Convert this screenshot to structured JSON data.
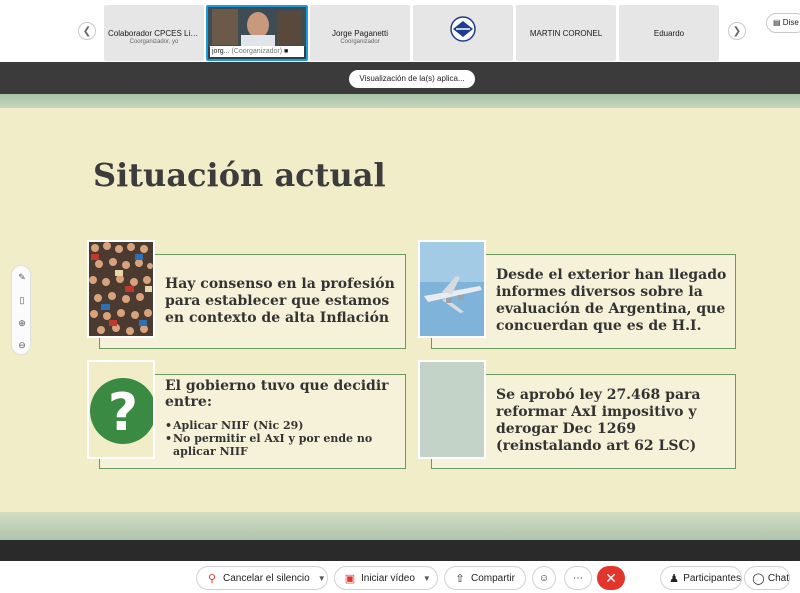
{
  "participants": [
    {
      "name": "Colaborador CPCES Liz ...",
      "role": "Coorganizador, yo"
    },
    {
      "name": "jorg...",
      "role": "(Coorganizador)"
    },
    {
      "name": "Jorge Paganetti",
      "role": "Coorganizador"
    },
    {
      "name": "",
      "role": ""
    },
    {
      "name": "MARTIN CORONEL",
      "role": ""
    },
    {
      "name": "Eduardo",
      "role": ""
    }
  ],
  "top": {
    "layout_button": "Dise"
  },
  "share_label": "Visualización de la(s) aplica...",
  "slide": {
    "title": "Situación actual",
    "box1": "Hay consenso en la profesión para establecer que estamos en contexto de alta Inflación",
    "box2": "Desde el exterior han llegado informes diversos sobre la evaluación de Argentina, que concuerdan que es de H.I.",
    "box3_head": "El gobierno tuvo que decidir entre:",
    "box3_bullets": [
      "Aplicar NIIF (Nic 29)",
      "No permitir el AxI y por ende no aplicar NIIF"
    ],
    "box4_line1": "Se aprobó ley 27.468 para",
    "box4_line2": "reformar AxI impositivo y",
    "box4_line3": "derogar  Dec 1269",
    "box4_line4": "(reinstalando art 62 LSC)"
  },
  "controls": {
    "mute": "Cancelar el silencio",
    "video": "Iniciar vídeo",
    "share": "Compartir",
    "participants": "Participantes",
    "chat": "Chat"
  },
  "colors": {
    "accent": "#1e9cd8",
    "end_call": "#e0362c",
    "slide_bg": "#f1edc9",
    "box_border": "#6a9a60"
  }
}
